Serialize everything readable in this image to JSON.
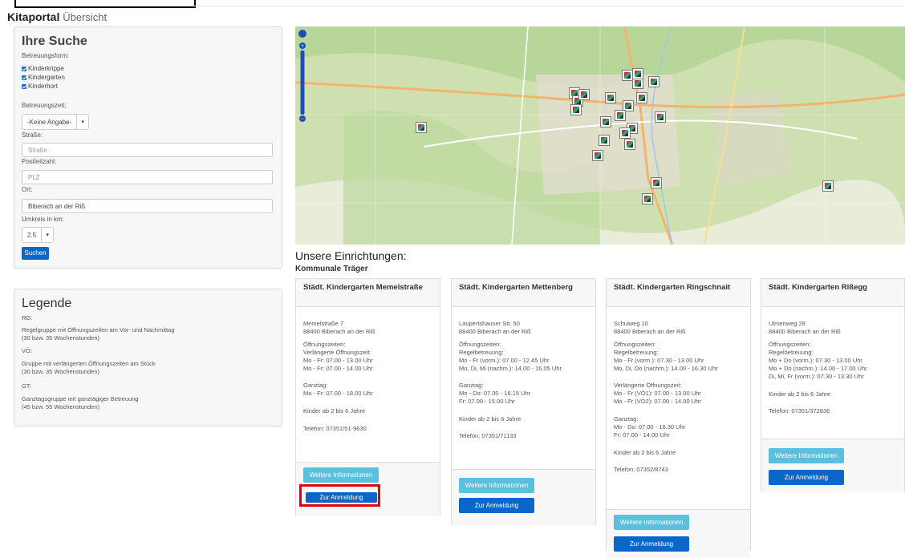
{
  "header": {
    "title": "Kitaportal",
    "subtitle": "Übersicht"
  },
  "search": {
    "heading": "Ihre Suche",
    "betreuungsform_label": "Betreuungsform:",
    "forms": [
      "Kinderkrippe",
      "Kindergarten",
      "Kinderhort"
    ],
    "betreuungszeit_label": "Betreuungszeit:",
    "betreuungszeit_value": "-Keine Angabe-",
    "strasse_label": "Straße:",
    "strasse_placeholder": "Straße",
    "plz_label": "Postleitzahl:",
    "plz_placeholder": "PLZ",
    "ort_label": "Ort:",
    "ort_value": "Biberach an der Riß",
    "umkreis_label": "Umkreis in km:",
    "umkreis_value": "2.5",
    "search_button": "Suchen"
  },
  "legend": {
    "heading": "Legende",
    "items": [
      {
        "code": "RG:",
        "text1": "Regelgruppe mit Öffnungszeiten am Vor- und Nachmittag",
        "text2": "(30 bzw. 35 Wochenstunden)"
      },
      {
        "code": "VÖ:",
        "text1": "Gruppe mit verlängerten Öffnungszeiten am Stück",
        "text2": "(30 bzw. 35 Wochenstunden)"
      },
      {
        "code": "GT:",
        "text1": "Ganztagsgruppe mit ganztägiger Betreuung",
        "text2": "(45 bzw. 55 Wochenstunden)"
      }
    ]
  },
  "results": {
    "heading": "Unsere Einrichtungen:",
    "sub": "Kommunale Träger"
  },
  "cards": [
    {
      "title": "Städt. Kindergarten Memelstraße",
      "lines": [
        "Memelstraße 7",
        "88400 Biberach an der Riß",
        "",
        "Öffnungszeiten:",
        "Verlängerte Öffnungszeit:",
        "Mo - Fr: 07.00 - 13.00 Uhr",
        "Mo - Fr: 07.00 - 14.00 Uhr",
        "",
        "Ganztag:",
        "Mo - Fr: 07.00 - 18.00 Uhr",
        "",
        "Kinder ab 2 bis 6 Jahre",
        "",
        "Telefon: 07351/51-9630"
      ],
      "info_button": "Weitere Informationen",
      "register_button": "Zur Anmeldung"
    },
    {
      "title": "Städt. Kindergarten Mettenberg",
      "lines": [
        "Laupertshauser Str. 50",
        "88400 Biberach an der Riß",
        "",
        "Öffnungszeiten:",
        "Regelbetreuung:",
        "Mo - Fr (vorm.): 07.00 - 12.45 Uhr",
        "Mo, Di, Mi (nachm.): 14.00 - 16.05 Uhr",
        "",
        "Ganztag:",
        "Mo - Do: 07.00 - 16.15 Uhr",
        "Fr: 07.00 - 15.00 Uhr",
        "",
        "Kinder ab 2 bis 6 Jahre",
        "",
        "Telefon: 07351/71133"
      ],
      "info_button": "Weitere Informationen",
      "register_button": "Zur Anmeldung"
    },
    {
      "title": "Städt. Kindergarten Ringschnait",
      "lines": [
        "Schulweg 10",
        "88400 Biberach an der Riß",
        "",
        "Öffnungszeiten:",
        "Regelbetreuung:",
        "Mo - Fr (vorm.): 07.30 - 13.00 Uhr",
        "Mo, Di, Do (nachm.): 14.00 - 16.30 Uhr",
        "",
        "Verlängerte Öffnungszeit:",
        "Mo - Fr (VÖ1): 07.00 - 13.00 Uhr",
        "Mo - Fr (VÖ2): 07.00 - 14.00 Uhr",
        "",
        "Ganztag:",
        "Mo - Do: 07.00 - 16.30 Uhr",
        "Fr: 07.00 - 14.00 Uhr",
        "",
        "Kinder ab 2 bis 6 Jahre",
        "",
        "Telefon: 07352/8743"
      ],
      "info_button": "Weitere Informationen",
      "register_button": "Zur Anmeldung"
    },
    {
      "title": "Städt. Kindergarten Rißegg",
      "lines": [
        "Ulmenweg 28",
        "88400 Biberach an der Riß",
        "",
        "Öffnungszeiten:",
        "Regelbetreuung:",
        "Mo + Do (vorm.): 07.30 - 13.00 Uhr",
        "Mo + Do (nachm.): 14.00 - 17.00 Uhr",
        "Di, Mi, Fr (vorm.): 07.30 - 13.30 Uhr",
        "",
        "Kinder ab 2 bis 6 Jahre",
        "",
        "Telefon: 07351/372836"
      ],
      "info_button": "Weitere Informationen",
      "register_button": "Zur Anmeldung"
    }
  ],
  "colors": {
    "primary": "#0b66c9",
    "info": "#5bc0de",
    "highlight": "#e3000f"
  }
}
